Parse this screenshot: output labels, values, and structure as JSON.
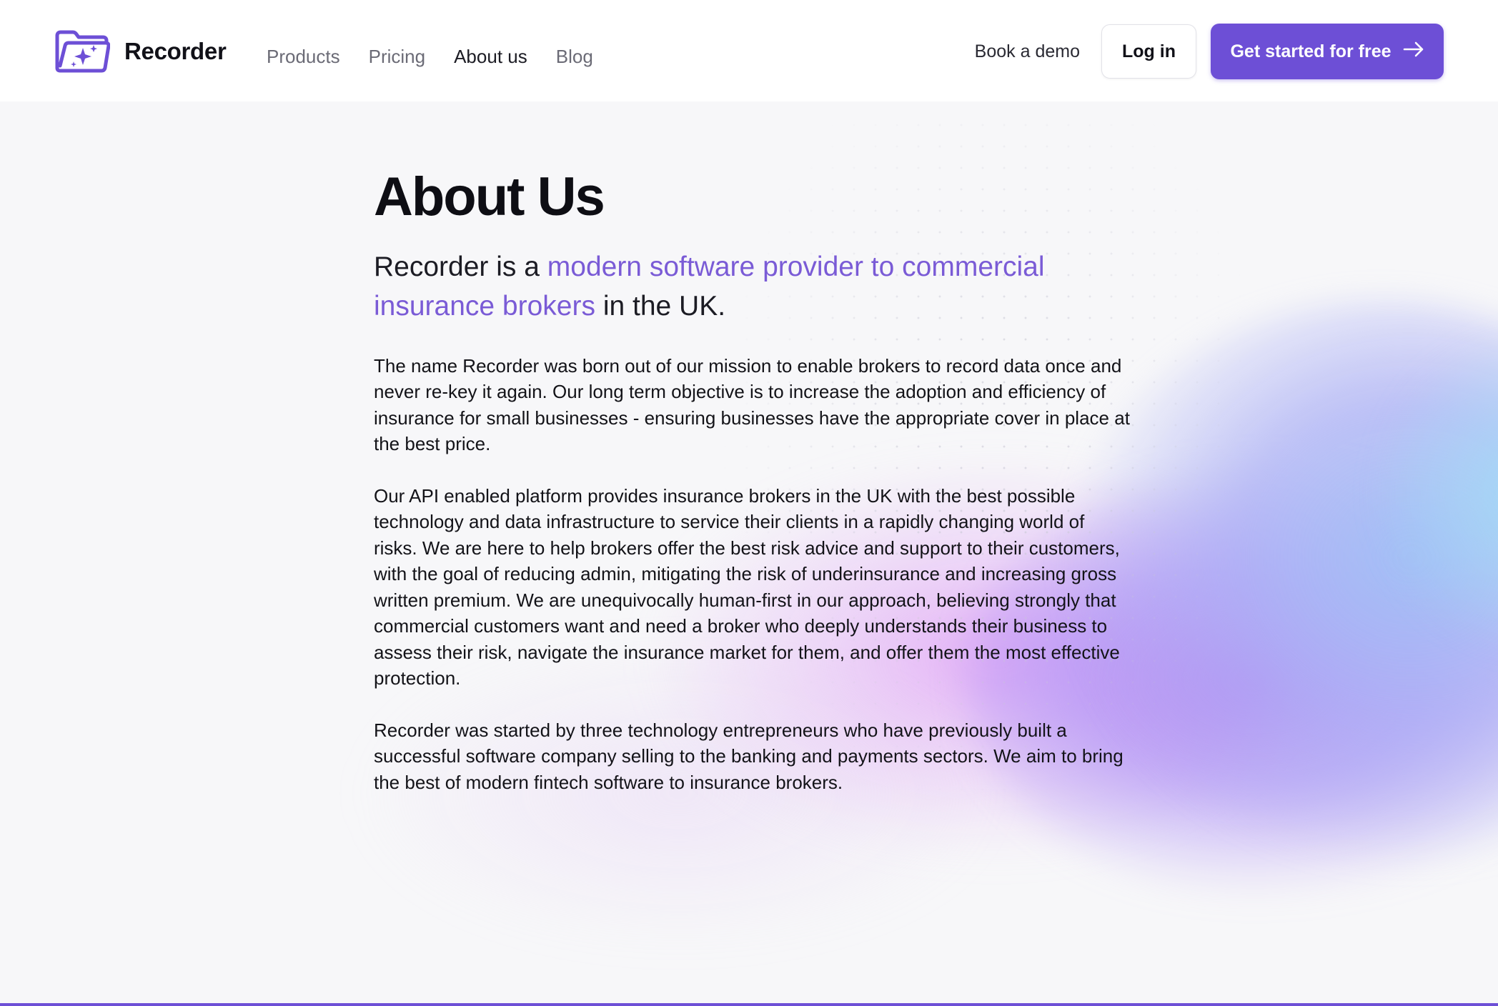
{
  "brand": {
    "name": "Recorder",
    "accent_color": "#6d4fd6",
    "logo_icon": "folder-sparkle-icon"
  },
  "nav": {
    "links": [
      {
        "label": "Products",
        "active": false
      },
      {
        "label": "Pricing",
        "active": false
      },
      {
        "label": "About us",
        "active": true
      },
      {
        "label": "Blog",
        "active": false
      }
    ],
    "book_demo": "Book a demo",
    "login": "Log in",
    "cta": "Get started for free",
    "cta_icon": "arrow-right-icon"
  },
  "main": {
    "title": "About Us",
    "lead_before": "Recorder is a ",
    "lead_accent": "modern software provider to commercial insurance brokers",
    "lead_after": " in the UK.",
    "paragraphs": [
      "The name Recorder was born out of our mission to enable brokers to record data once and never re-key it again. Our long term objective is to increase the adoption and efficiency of insurance for small businesses - ensuring businesses have the appropriate cover in place at the best price.",
      "Our API enabled platform provides insurance brokers in the UK with the best possible technology and data infrastructure to service their clients in a rapidly changing world of risks. We are here to help brokers offer the best risk advice and support to their customers, with the goal of reducing admin, mitigating the risk of underinsurance and increasing gross written premium. We are unequivocally human-first in our approach, believing strongly that commercial customers want and need a broker who deeply understands their business to assess their risk, navigate the insurance market for them, and offer them the most effective protection.",
      "Recorder was started by three technology entrepreneurs who have previously built a successful software company selling to the banking and payments sectors. We aim to bring the best of modern fintech software to insurance brokers."
    ]
  }
}
